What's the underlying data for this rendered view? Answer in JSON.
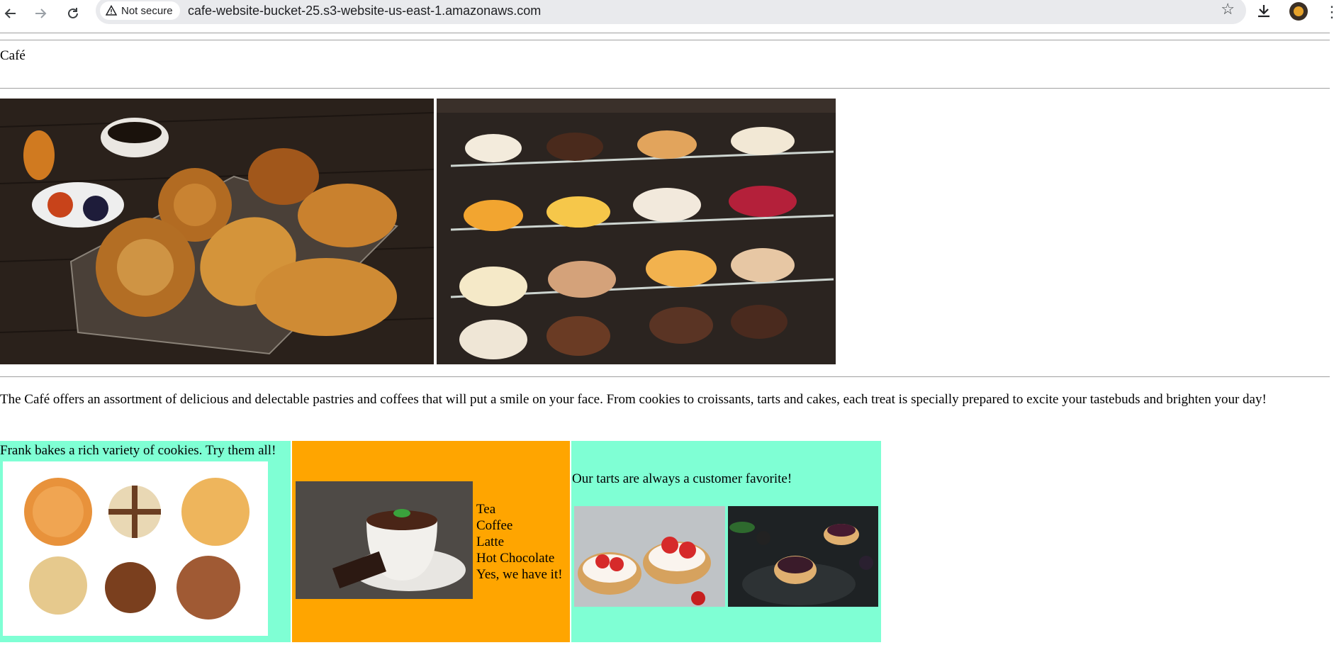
{
  "browser": {
    "security_label": "Not secure",
    "url": "cafe-website-bucket-25.s3-website-us-east-1.amazonaws.com",
    "icons": [
      "back-arrow-icon",
      "forward-arrow-icon",
      "reload-icon",
      "warning-icon",
      "star-icon",
      "download-icon",
      "avatar",
      "more-vert-icon"
    ]
  },
  "page": {
    "title": "Café",
    "intro": "The Café offers an assortment of delicious and delectable pastries and coffees that will put a smile on your face. From cookies to croissants, tarts and cakes, each treat is specially prepared to excite your tastebuds and brighten your day!",
    "cookies_text": "Frank bakes a rich variety of cookies. Try them all!",
    "drinks": [
      "Tea",
      "Coffee",
      "Latte",
      "Hot Chocolate",
      "Yes, we have it!"
    ],
    "tarts_text": "Our tarts are always a customer favorite!"
  },
  "colors": {
    "aquamarine": "#7fffd4",
    "orange": "#ffa500"
  }
}
